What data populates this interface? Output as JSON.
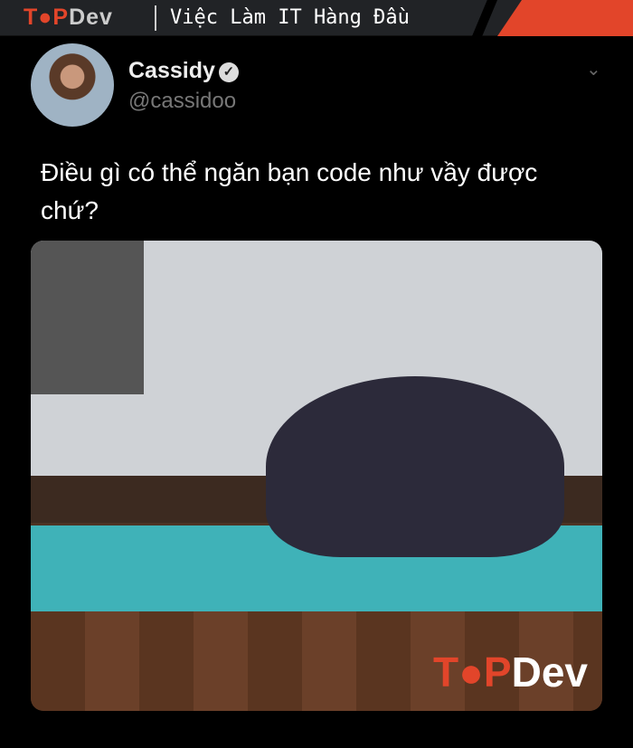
{
  "banner": {
    "logo_top": "T",
    "logo_o": "●",
    "logo_p": "P",
    "logo_dev": "Dev",
    "tagline": "Việc Làm IT Hàng Đầu"
  },
  "tweet": {
    "name": "Cassidy",
    "verified_icon": "✓",
    "handle": "@cassidoo",
    "menu_icon": "⌄",
    "text": "Điều gì có thể ngăn bạn code như vầy được chứ?"
  },
  "image": {
    "watermark_top": "T",
    "watermark_o": "●",
    "watermark_p": "P",
    "watermark_dev": "Dev"
  },
  "colors": {
    "brand": "#e2452a"
  }
}
